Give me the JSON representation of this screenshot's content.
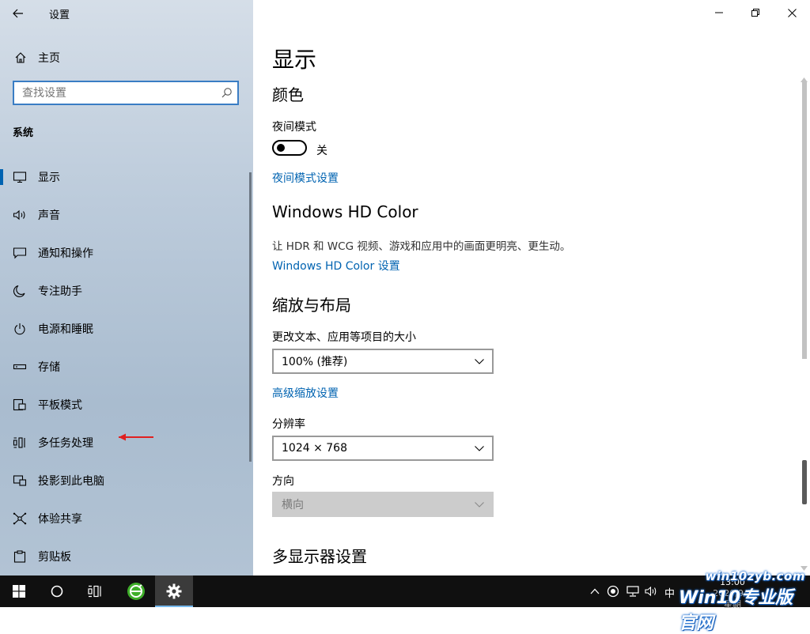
{
  "app": {
    "title": "设置",
    "back_icon": "back-arrow-icon"
  },
  "home": {
    "label": "主页",
    "icon": "home-icon"
  },
  "search": {
    "placeholder": "查找设置",
    "value": ""
  },
  "nav": {
    "section": "系统",
    "items": [
      {
        "label": "显示",
        "icon": "monitor-icon",
        "active": true
      },
      {
        "label": "声音",
        "icon": "speaker-icon"
      },
      {
        "label": "通知和操作",
        "icon": "notification-icon"
      },
      {
        "label": "专注助手",
        "icon": "moon-icon"
      },
      {
        "label": "电源和睡眠",
        "icon": "power-icon"
      },
      {
        "label": "存储",
        "icon": "storage-icon"
      },
      {
        "label": "平板模式",
        "icon": "tablet-icon"
      },
      {
        "label": "多任务处理",
        "icon": "multitask-icon"
      },
      {
        "label": "投影到此电脑",
        "icon": "project-icon"
      },
      {
        "label": "体验共享",
        "icon": "share-icon"
      },
      {
        "label": "剪贴板",
        "icon": "clipboard-icon"
      }
    ]
  },
  "content": {
    "page_title": "显示",
    "color": {
      "heading": "颜色",
      "night_light_label": "夜间模式",
      "night_light_state": "关",
      "night_light_on": false,
      "night_light_settings_link": "夜间模式设置"
    },
    "hdr": {
      "heading": "Windows HD Color",
      "description": "让 HDR 和 WCG 视频、游戏和应用中的画面更明亮、更生动。",
      "settings_link": "Windows HD Color 设置"
    },
    "scale": {
      "heading": "缩放与布局",
      "size_label": "更改文本、应用等项目的大小",
      "size_value": "100% (推荐)",
      "advanced_link": "高级缩放设置",
      "resolution_label": "分辨率",
      "resolution_value": "1024 × 768",
      "orientation_label": "方向",
      "orientation_value": "横向"
    },
    "multi_display": {
      "heading": "多显示器设置"
    }
  },
  "taskbar": {
    "ime": "中",
    "time": "13:00",
    "date": "2020/9/3 星期"
  },
  "watermark": {
    "line1": "win10zyb.com",
    "line2": "Win10专业版官网"
  },
  "colors": {
    "accent": "#0063b1",
    "annotation_arrow": "#e02020",
    "taskbar": "#101010"
  }
}
